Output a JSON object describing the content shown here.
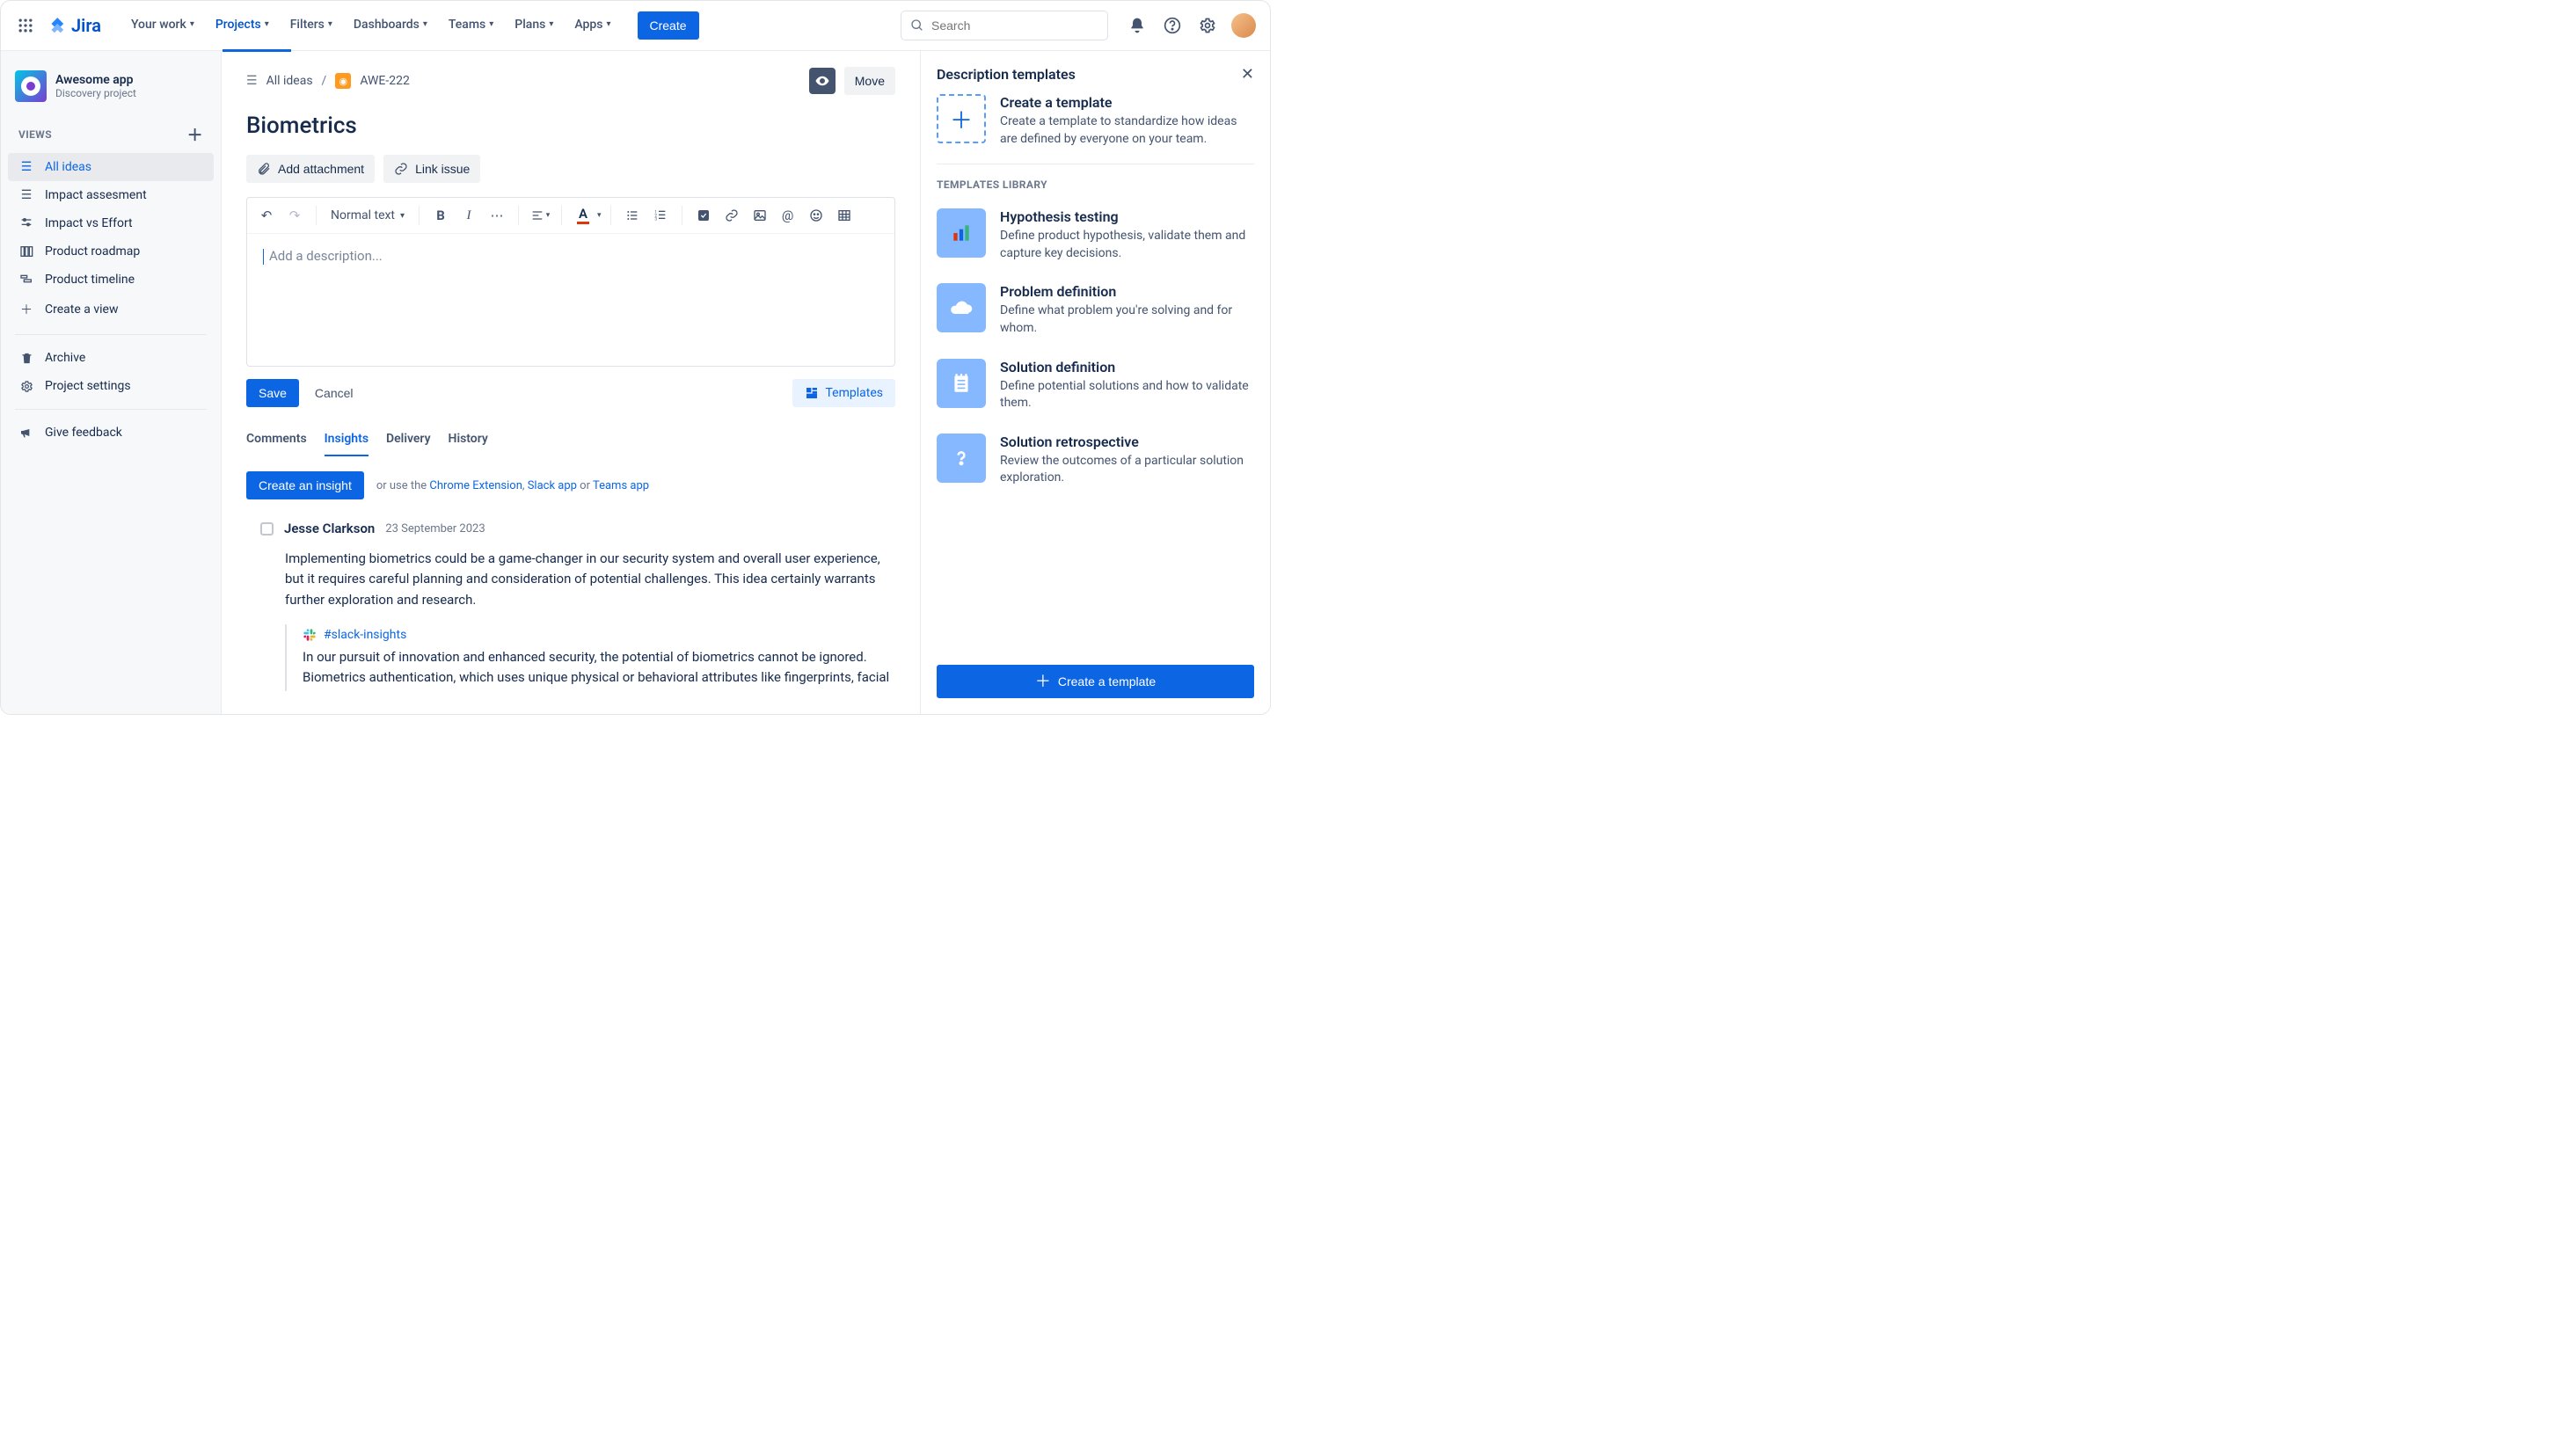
{
  "topnav": {
    "logo": "Jira",
    "items": [
      {
        "label": "Your work"
      },
      {
        "label": "Projects",
        "active": true
      },
      {
        "label": "Filters"
      },
      {
        "label": "Dashboards"
      },
      {
        "label": "Teams"
      },
      {
        "label": "Plans"
      },
      {
        "label": "Apps"
      }
    ],
    "create": "Create",
    "search_placeholder": "Search"
  },
  "sidebar": {
    "project_name": "Awesome app",
    "project_type": "Discovery project",
    "views_label": "VIEWS",
    "views": [
      {
        "label": "All ideas",
        "icon": "list",
        "active": true
      },
      {
        "label": "Impact assesment",
        "icon": "list"
      },
      {
        "label": "Impact vs Effort",
        "icon": "slider"
      },
      {
        "label": "Product roadmap",
        "icon": "columns"
      },
      {
        "label": "Product timeline",
        "icon": "timeline"
      },
      {
        "label": "Create a view",
        "icon": "plus"
      }
    ],
    "archive": "Archive",
    "settings": "Project settings",
    "feedback": "Give feedback"
  },
  "breadcrumb": {
    "root": "All ideas",
    "issue_key": "AWE-222",
    "move": "Move"
  },
  "issue": {
    "title": "Biometrics",
    "add_attachment": "Add attachment",
    "link_issue": "Link issue"
  },
  "editor": {
    "text_style": "Normal text",
    "placeholder": "Add a description...",
    "save": "Save",
    "cancel": "Cancel",
    "templates": "Templates"
  },
  "tabs": {
    "items": [
      "Comments",
      "Insights",
      "Delivery",
      "History"
    ],
    "active": 1
  },
  "insights": {
    "create": "Create an insight",
    "or_prefix": "or use the ",
    "link1": "Chrome Extension",
    "sep1": ", ",
    "link2": "Slack app",
    "sep2": " or ",
    "link3": "Teams app",
    "entry": {
      "author": "Jesse Clarkson",
      "date": "23 September 2023",
      "text": "Implementing biometrics could be a game-changer in our security system and overall user experience, but it requires careful planning and consideration of potential challenges. This idea certainly warrants further exploration and research.",
      "slack_channel": "#slack-insights",
      "slack_text": "In our pursuit of innovation and enhanced security, the potential of biometrics cannot be ignored. Biometrics authentication, which uses unique physical or behavioral attributes like fingerprints, facial"
    }
  },
  "rpanel": {
    "title": "Description templates",
    "create": {
      "title": "Create a template",
      "desc": "Create a template to standardize how ideas are defined by everyone on your team."
    },
    "library_label": "TEMPLATES LIBRARY",
    "items": [
      {
        "title": "Hypothesis testing",
        "desc": "Define product hypothesis, validate them and capture key decisions.",
        "icon": "hyp"
      },
      {
        "title": "Problem definition",
        "desc": "Define what problem you're solving and for whom.",
        "icon": "prob"
      },
      {
        "title": "Solution definition",
        "desc": "Define potential solutions and how to validate them.",
        "icon": "sol"
      },
      {
        "title": "Solution retrospective",
        "desc": "Review the outcomes of a particular solution exploration.",
        "icon": "retro"
      }
    ],
    "footer_btn": "Create a template"
  }
}
